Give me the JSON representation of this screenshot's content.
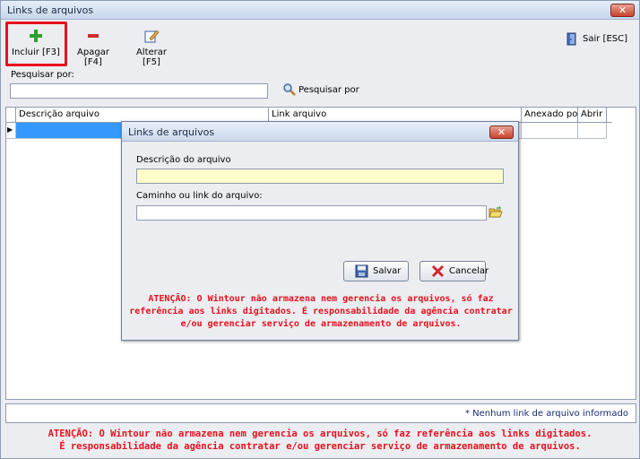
{
  "window": {
    "title": "Links de arquivos",
    "close_glyph": "✕"
  },
  "toolbar": {
    "include_label": "Incluir [F3]",
    "delete_label": "Apagar [F4]",
    "edit_label": "Alterar [F5]",
    "exit_label": "Sair [ESC]"
  },
  "search": {
    "label": "Pesquisar por:",
    "value": "",
    "button_label": "Pesquisar por"
  },
  "grid": {
    "columns": [
      "Descrição arquivo",
      "Link arquivo",
      "Anexado por",
      "Abrir"
    ],
    "row_indicator": "▶"
  },
  "status": {
    "text": "* Nenhum link de arquivo informado"
  },
  "bottom_warning": {
    "line1": "ATENÇÃO: O Wintour não armazena nem gerencia os arquivos, só faz referência aos links digitados.",
    "line2": "É responsabilidade da agência contratar e/ou gerenciar serviço de armazenamento de arquivos."
  },
  "dialog": {
    "title": "Links de arquivos",
    "description_label": "Descrição do arquivo",
    "description_value": "",
    "path_label": "Caminho ou link do arquivo:",
    "path_value": "",
    "save_label": "Salvar",
    "cancel_label": "Cancelar",
    "warning_line1": "ATENÇÃO: O Wintour não armazena nem gerencia os arquivos, só faz",
    "warning_line2": "referência aos links digitados. É responsabilidade da agência contratar",
    "warning_line3": "e/ou gerenciar serviço de armazenamento de arquivos."
  },
  "colors": {
    "warning": "#e8101e",
    "highlight": "#e8101e",
    "selection": "#3399ff"
  },
  "icons": [
    "plus-icon",
    "minus-icon",
    "edit-icon",
    "exit-door-icon",
    "search-magnifier-icon",
    "folder-open-icon",
    "save-disk-icon",
    "cancel-x-icon"
  ]
}
